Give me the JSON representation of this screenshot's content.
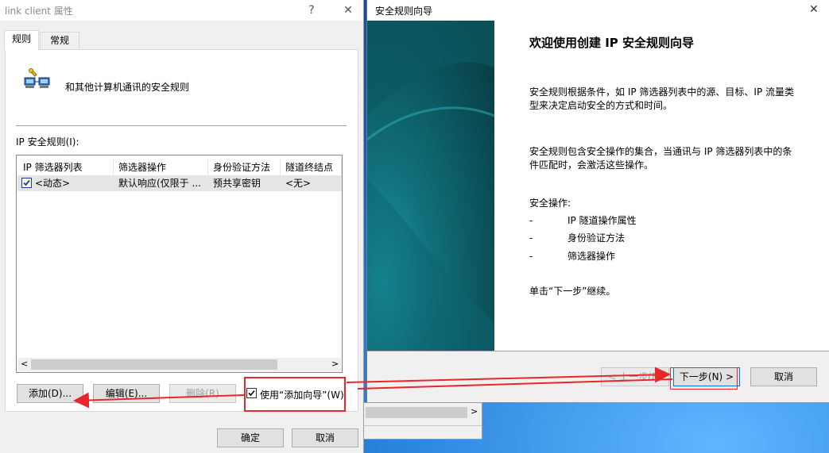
{
  "left_dialog": {
    "title": "link client 属性",
    "help_glyph": "?",
    "close_glyph": "✕",
    "tabs": [
      {
        "label": "规则"
      },
      {
        "label": "常规"
      }
    ],
    "description": "和其他计算机通讯的安全规则",
    "rules_label": "IP 安全规则(I):",
    "columns": [
      "IP 筛选器列表",
      "筛选器操作",
      "身份验证方法",
      "隧道终结点"
    ],
    "rows": [
      {
        "checked": true,
        "filter_list": "<动态>",
        "filter_action": "默认响应(仅限于 ...",
        "auth_method": "预共享密钥",
        "tunnel": "<无>"
      }
    ],
    "scroll_left": "<",
    "scroll_right": ">",
    "add_button": "添加(D)...",
    "edit_button": "编辑(E)...",
    "delete_button": "删除(R)",
    "wizard_checkbox_label": "使用“添加向导”(W)",
    "wizard_checkbox_checked": true,
    "ok_button": "确定",
    "cancel_button": "取消"
  },
  "wizard": {
    "title": "安全规则向导",
    "close_glyph": "✕",
    "heading": "欢迎使用创建 IP 安全规则向导",
    "para1_line1": "安全规则根据条件，如 IP 筛选器列表中的源、目标、IP 流量类",
    "para1_line2": "型来决定启动安全的方式和时间。",
    "para2_line1": "安全规则包含安全操作的集合，当通讯与 IP 筛选器列表中的条",
    "para2_line2": "件匹配时，会激活这些操作。",
    "actions_label": "安全操作:",
    "actions": [
      {
        "bullet": "-",
        "text": "IP 隧道操作属性"
      },
      {
        "bullet": "-",
        "text": "身份验证方法"
      },
      {
        "bullet": "-",
        "text": "筛选器操作"
      }
    ],
    "continue_text": "单击“下一步”继续。",
    "back_button": "< 上一步(B)",
    "next_button": "下一步(N) >",
    "cancel_button": "取消"
  },
  "background_window": {
    "scroll_right": ">"
  },
  "colors": {
    "annotation": "#e8262c",
    "banner": "#0a4f57",
    "focus": "#0078d7"
  }
}
